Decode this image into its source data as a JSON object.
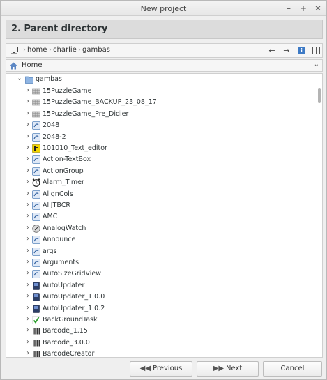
{
  "window": {
    "title": "New project"
  },
  "step": {
    "title": "2. Parent directory"
  },
  "breadcrumb": [
    "home",
    "charlie",
    "gambas"
  ],
  "places": {
    "selected": "Home"
  },
  "tree": {
    "root": "gambas",
    "items": [
      {
        "name": "15PuzzleGame",
        "icon": "folder-grid-icon"
      },
      {
        "name": "15PuzzleGame_BACKUP_23_08_17",
        "icon": "folder-grid-icon"
      },
      {
        "name": "15PuzzleGame_Pre_Didier",
        "icon": "folder-grid-icon"
      },
      {
        "name": "2048",
        "icon": "gambas-project-icon"
      },
      {
        "name": "2048-2",
        "icon": "gambas-project-icon"
      },
      {
        "name": "101010_Text_editor",
        "icon": "text-editor-icon"
      },
      {
        "name": "Action-TextBox",
        "icon": "gambas-project-icon"
      },
      {
        "name": "ActionGroup",
        "icon": "gambas-project-icon"
      },
      {
        "name": "Alarm_Timer",
        "icon": "alarm-clock-icon"
      },
      {
        "name": "AlignCols",
        "icon": "gambas-project-icon"
      },
      {
        "name": "AllJTBCR",
        "icon": "gambas-project-icon"
      },
      {
        "name": "AMC",
        "icon": "gambas-project-icon"
      },
      {
        "name": "AnalogWatch",
        "icon": "analog-watch-icon"
      },
      {
        "name": "Announce",
        "icon": "gambas-project-icon"
      },
      {
        "name": "args",
        "icon": "gambas-project-icon"
      },
      {
        "name": "Arguments",
        "icon": "gambas-project-icon"
      },
      {
        "name": "AutoSizeGridView",
        "icon": "gambas-project-icon"
      },
      {
        "name": "AutoUpdater",
        "icon": "updater-icon"
      },
      {
        "name": "AutoUpdater_1.0.0",
        "icon": "updater-icon"
      },
      {
        "name": "AutoUpdater_1.0.2",
        "icon": "updater-icon"
      },
      {
        "name": "BackGroundTask",
        "icon": "checkmark-icon"
      },
      {
        "name": "Barcode_1.15",
        "icon": "barcode-icon"
      },
      {
        "name": "Barcode_3.0.0",
        "icon": "barcode-icon"
      },
      {
        "name": "BarcodeCreator",
        "icon": "barcode-icon"
      }
    ]
  },
  "buttons": {
    "previous": "Previous",
    "next": "Next",
    "cancel": "Cancel"
  },
  "colors": {
    "accent": "#3d7ac5",
    "folder": "#8fb5e3"
  }
}
